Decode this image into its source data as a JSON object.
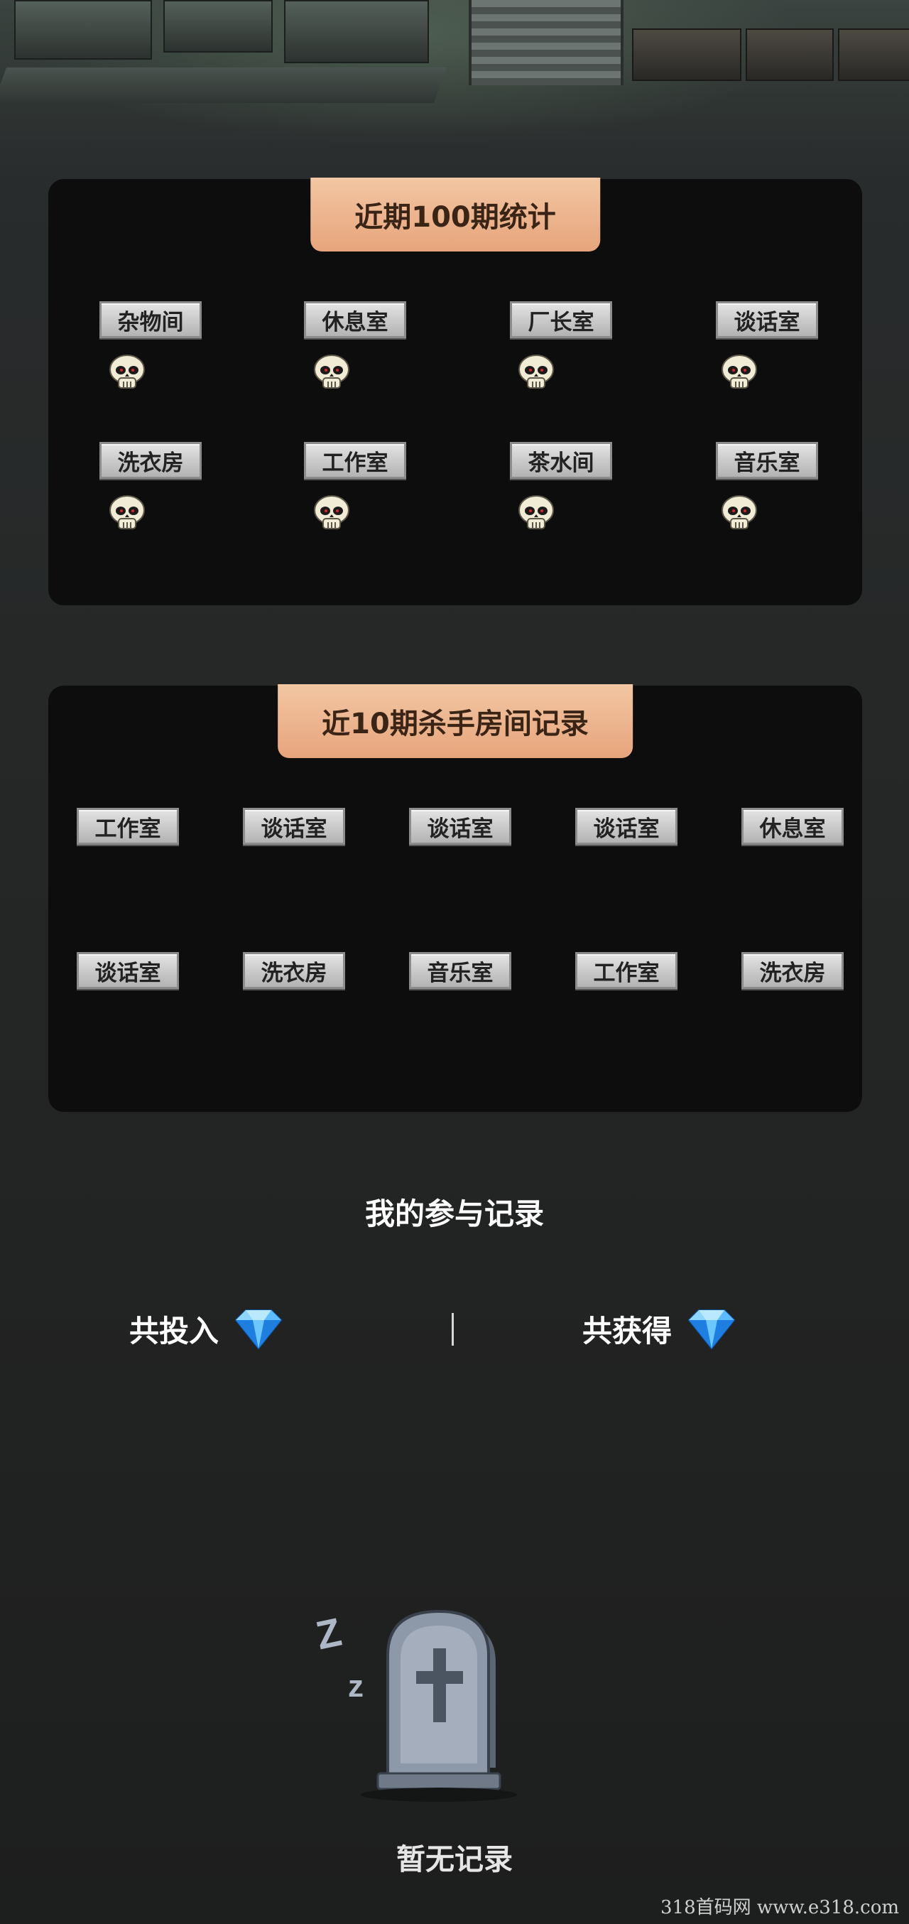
{
  "stats_100": {
    "title": "近期100期统计",
    "rooms": [
      {
        "label": "杂物间"
      },
      {
        "label": "休息室"
      },
      {
        "label": "厂长室"
      },
      {
        "label": "谈话室"
      },
      {
        "label": "洗衣房"
      },
      {
        "label": "工作室"
      },
      {
        "label": "茶水间"
      },
      {
        "label": "音乐室"
      }
    ],
    "icon": "skull-icon"
  },
  "recent_10": {
    "title": "近10期杀手房间记录",
    "records": [
      "工作室",
      "谈话室",
      "谈话室",
      "谈话室",
      "休息室",
      "谈话室",
      "洗衣房",
      "音乐室",
      "工作室",
      "洗衣房"
    ]
  },
  "participation": {
    "title": "我的参与记录",
    "total_invested_label": "共投入",
    "total_earned_label": "共获得",
    "currency_icon": "diamond-icon",
    "empty_text": "暂无记录",
    "empty_icon": "tombstone-sleeping-icon"
  },
  "watermark": "318首码网  www.e318.com",
  "colors": {
    "tab_bg": "#eba980",
    "panel_bg": "#0d0d0e",
    "page_bg": "#252727",
    "tag_bg": "#cfcfcf"
  }
}
